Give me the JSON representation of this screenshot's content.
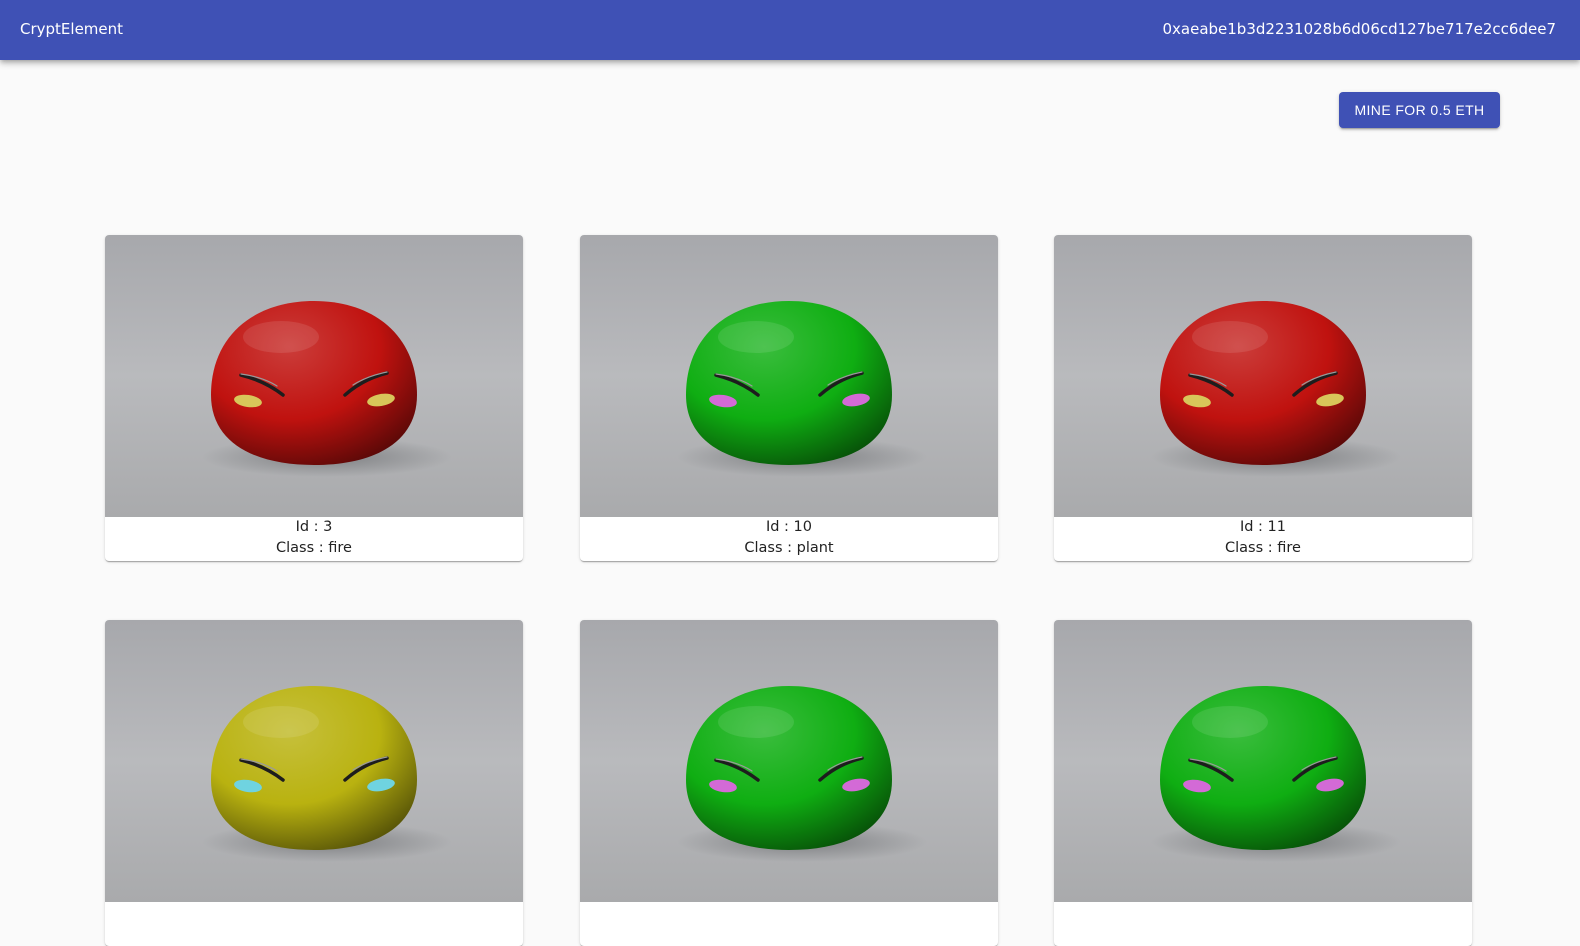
{
  "appbar": {
    "title": "CryptElement",
    "account": "0xaeabe1b3d2231028b6d06cd127be717e2cc6dee7",
    "color": "#3f51b5"
  },
  "actions": {
    "mine_label": "MINE FOR 0.5 ETH"
  },
  "cards": [
    {
      "id_text": "Id : 3",
      "class_text": "Class : fire",
      "slime_color": "#c0120f",
      "cheek_color": "#d8c65a"
    },
    {
      "id_text": "Id : 10",
      "class_text": "Class : plant",
      "slime_color": "#0fae12",
      "cheek_color": "#d36ad6"
    },
    {
      "id_text": "Id : 11",
      "class_text": "Class : fire",
      "slime_color": "#c0120f",
      "cheek_color": "#d8c65a"
    },
    {
      "id_text": "",
      "class_text": "",
      "slime_color": "#b9b210",
      "cheek_color": "#6fd3e0"
    },
    {
      "id_text": "",
      "class_text": "",
      "slime_color": "#0fae12",
      "cheek_color": "#d36ad6"
    },
    {
      "id_text": "",
      "class_text": "",
      "slime_color": "#0fae12",
      "cheek_color": "#d36ad6"
    }
  ]
}
